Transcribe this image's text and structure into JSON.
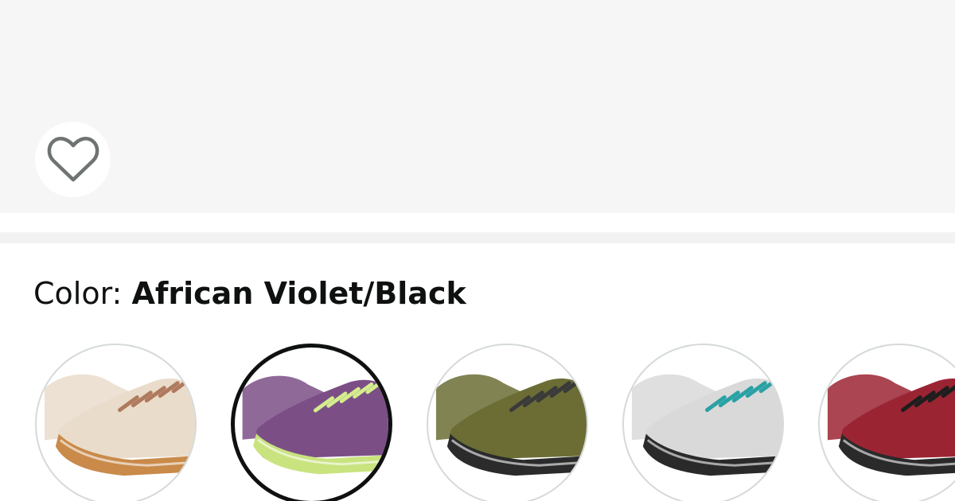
{
  "product": {
    "wishlist_icon": "heart-outline-icon"
  },
  "color_selector": {
    "label": "Color: ",
    "selected_value": "African Violet/Black",
    "swatches": [
      {
        "name": "cream-tan-shoe",
        "colors": {
          "upper": "#e9dccb",
          "sole": "#c98a4a",
          "lace": "#b07a5e"
        },
        "selected": false
      },
      {
        "name": "african-violet-black-shoe",
        "colors": {
          "upper": "#7b4f86",
          "sole": "#c9e37f",
          "lace": "#d4ec8e"
        },
        "selected": true
      },
      {
        "name": "olive-black-shoe",
        "colors": {
          "upper": "#6b6d35",
          "sole": "#2b2b2b",
          "lace": "#3a3a3a"
        },
        "selected": false
      },
      {
        "name": "grey-teal-black-shoe",
        "colors": {
          "upper": "#d9d9d9",
          "sole": "#2a2a2a",
          "lace": "#2aa1a4"
        },
        "selected": false
      },
      {
        "name": "red-black-shoe",
        "colors": {
          "upper": "#9b2433",
          "sole": "#2a2a2a",
          "lace": "#1e1e1e"
        },
        "selected": false
      }
    ]
  }
}
